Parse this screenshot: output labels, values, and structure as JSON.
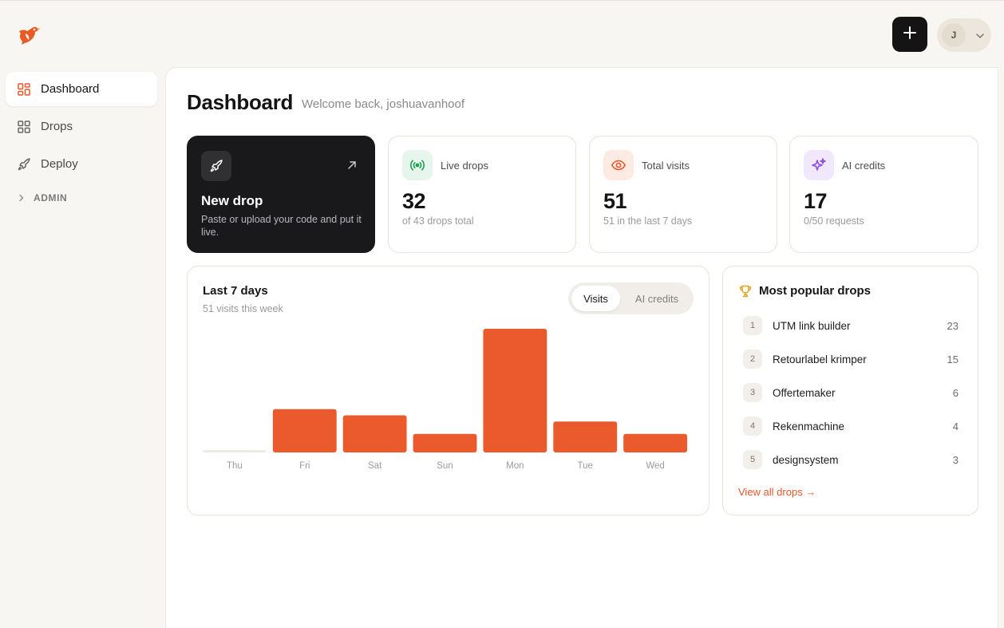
{
  "app": {
    "logo": "bird-logo-icon"
  },
  "topbar": {
    "add_icon": "plus-icon",
    "avatar_initial": "J",
    "menu_icon": "chevron-down-icon"
  },
  "sidebar": {
    "items": [
      {
        "label": "Dashboard",
        "icon": "grid-icon",
        "active": true
      },
      {
        "label": "Drops",
        "icon": "grid-icon",
        "active": false
      },
      {
        "label": "Deploy",
        "icon": "rocket-icon",
        "active": false
      }
    ],
    "admin_label": "ADMIN"
  },
  "header": {
    "title": "Dashboard",
    "welcome": "Welcome back, joshuavanhoof"
  },
  "new_drop": {
    "title": "New drop",
    "description": "Paste or upload your code and put it live."
  },
  "stats": [
    {
      "label": "Live drops",
      "value": "32",
      "sub": "of 43 drops total",
      "icon": "broadcast-icon",
      "color": "#1f9d55",
      "bg": "#e7f6ec"
    },
    {
      "label": "Total visits",
      "value": "51",
      "sub": "51 in the last 7 days",
      "icon": "eye-icon",
      "color": "#e8582a",
      "bg": "#fdebe3"
    },
    {
      "label": "AI credits",
      "value": "17",
      "sub": "0/50 requests",
      "icon": "sparkle-icon",
      "color": "#8b46e8",
      "bg": "#f1e8fd"
    }
  ],
  "chart_panel": {
    "title": "Last 7 days",
    "subtitle": "51 visits this week",
    "toggle": {
      "active": "Visits",
      "inactive": "AI credits"
    }
  },
  "chart_data": {
    "type": "bar",
    "categories": [
      "Thu",
      "Fri",
      "Sat",
      "Sun",
      "Mon",
      "Tue",
      "Wed"
    ],
    "values": [
      0,
      7,
      6,
      3,
      20,
      5,
      3
    ],
    "color": "#eb5a2c",
    "empty_color": "#efebe4"
  },
  "popular": {
    "title": "Most popular drops",
    "items": [
      {
        "rank": "1",
        "name": "UTM link builder",
        "count": "23"
      },
      {
        "rank": "2",
        "name": "Retourlabel krimper",
        "count": "15"
      },
      {
        "rank": "3",
        "name": "Offertemaker",
        "count": "6"
      },
      {
        "rank": "4",
        "name": "Rekenmachine",
        "count": "4"
      },
      {
        "rank": "5",
        "name": "designsystem",
        "count": "3"
      }
    ],
    "view_all": "View all drops →"
  },
  "colors": {
    "accent": "#e8582a",
    "dark": "#19191b",
    "background": "#f8f6f2"
  }
}
